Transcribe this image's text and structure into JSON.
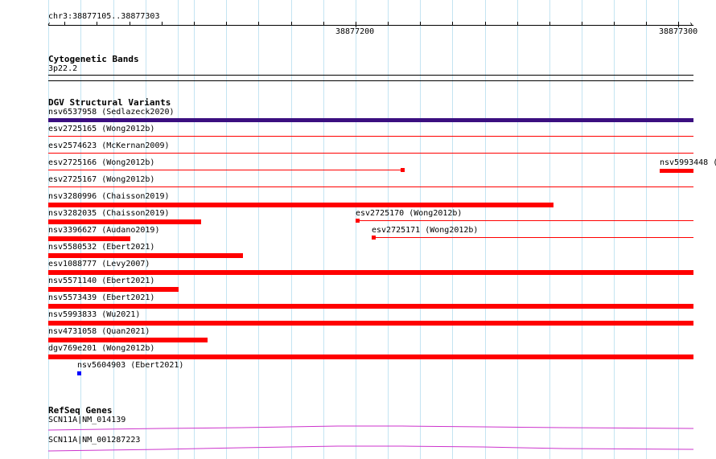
{
  "ruler": {
    "coord_label": "chr3:38877105..38877303",
    "tick1": "38877200",
    "tick2": "38877300"
  },
  "cytoband": {
    "title": "Cytogenetic Bands",
    "band": "3p22.2"
  },
  "dgv": {
    "title": "DGV Structural Variants",
    "items": [
      {
        "label": "nsv6537958 (Sedlazeck2020)",
        "color": "#3b0f80"
      },
      {
        "label": "esv2725165 (Wong2012b)",
        "color": "#ff0000"
      },
      {
        "label": "esv2574623 (McKernan2009)",
        "color": "#ff0000"
      },
      {
        "label": "esv2725166 (Wong2012b)",
        "color": "#ff0000"
      },
      {
        "label": "nsv5993448 (",
        "color": "#ff0000"
      },
      {
        "label": "esv2725167 (Wong2012b)",
        "color": "#ff0000"
      },
      {
        "label": "nsv3280996 (Chaisson2019)",
        "color": "#ff0000"
      },
      {
        "label": "nsv3282035 (Chaisson2019)",
        "color": "#ff0000"
      },
      {
        "label": "esv2725170 (Wong2012b)",
        "color": "#ff0000"
      },
      {
        "label": "nsv3396627 (Audano2019)",
        "color": "#ff0000"
      },
      {
        "label": "esv2725171 (Wong2012b)",
        "color": "#ff0000"
      },
      {
        "label": "nsv5580532 (Ebert2021)",
        "color": "#ff0000"
      },
      {
        "label": "esv1088777 (Levy2007)",
        "color": "#ff0000"
      },
      {
        "label": "nsv5571140 (Ebert2021)",
        "color": "#ff0000"
      },
      {
        "label": "nsv5573439 (Ebert2021)",
        "color": "#ff0000"
      },
      {
        "label": "nsv5993833 (Wu2021)",
        "color": "#ff0000"
      },
      {
        "label": "nsv4731058 (Quan2021)",
        "color": "#ff0000"
      },
      {
        "label": "dgv769e201 (Wong2012b)",
        "color": "#ff0000"
      },
      {
        "label": "nsv5604903 (Ebert2021)",
        "color": "#0000ff"
      }
    ]
  },
  "refseq": {
    "title": "RefSeq Genes",
    "genes": [
      {
        "label": "SCN11A|NM_014139",
        "color": "#cc33cc"
      },
      {
        "label": "SCN11A|NM_001287223",
        "color": "#cc33cc"
      }
    ]
  }
}
